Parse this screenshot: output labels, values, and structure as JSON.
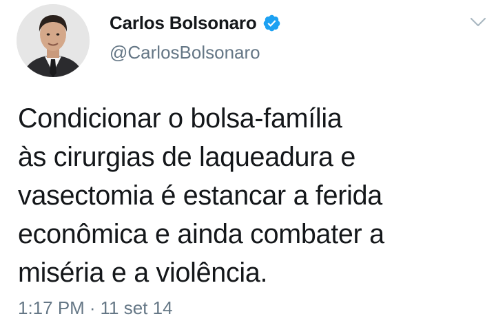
{
  "user": {
    "display_name": "Carlos Bolsonaro",
    "handle": "@CarlosBolsonaro",
    "verified": true,
    "avatar_icon": "profile-photo"
  },
  "tweet": {
    "text": "Condicionar o bolsa-família\nàs cirurgias de laqueadura e\nvasectomia é estancar a ferida\neconômica e ainda combater a\nmiséria e a violência.",
    "time": "1:17 PM",
    "separator": "·",
    "date": "11 set 14"
  },
  "icons": {
    "verified": "verified-badge-icon",
    "menu": "chevron-down-icon"
  },
  "colors": {
    "text": "#14171a",
    "secondary": "#657786",
    "verified_blue": "#1da1f2",
    "background": "#ffffff"
  }
}
